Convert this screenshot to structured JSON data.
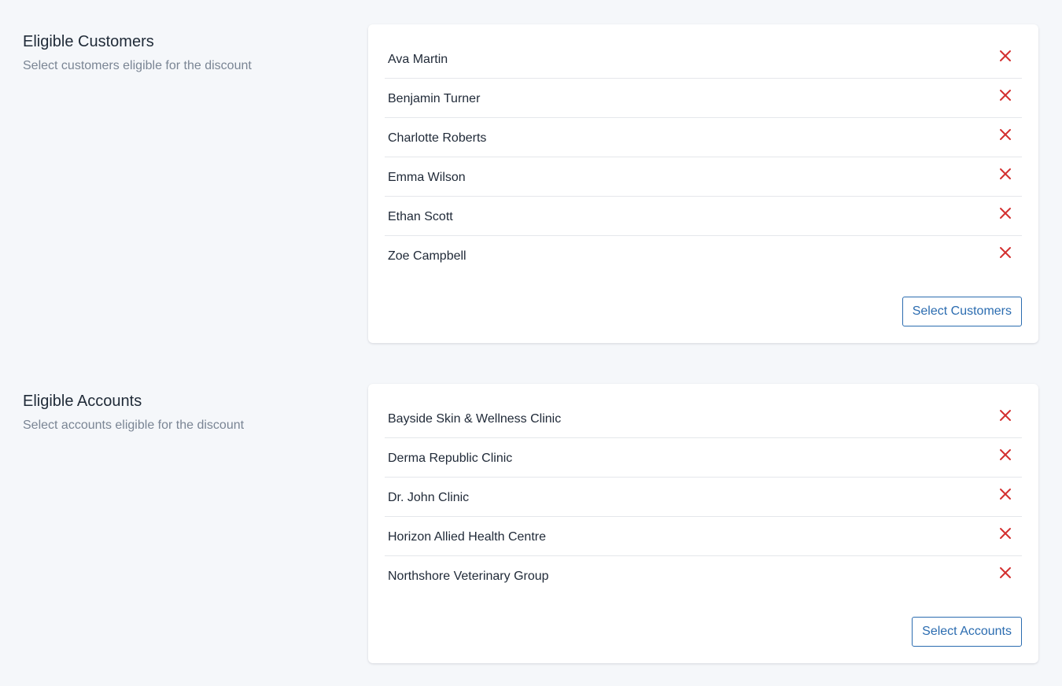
{
  "customers": {
    "title": "Eligible Customers",
    "description": "Select customers eligible for the discount",
    "items": [
      {
        "name": "Ava Martin"
      },
      {
        "name": "Benjamin Turner"
      },
      {
        "name": "Charlotte Roberts"
      },
      {
        "name": "Emma Wilson"
      },
      {
        "name": "Ethan Scott"
      },
      {
        "name": "Zoe Campbell"
      }
    ],
    "select_label": "Select Customers"
  },
  "accounts": {
    "title": "Eligible Accounts",
    "description": "Select accounts eligible for the discount",
    "items": [
      {
        "name": "Bayside Skin & Wellness Clinic"
      },
      {
        "name": "Derma Republic Clinic"
      },
      {
        "name": "Dr. John Clinic"
      },
      {
        "name": "Horizon Allied Health Centre"
      },
      {
        "name": "Northshore Veterinary Group"
      }
    ],
    "select_label": "Select Accounts"
  },
  "icons": {
    "remove": "close-icon"
  },
  "colors": {
    "background": "#f5f7fa",
    "remove_icon": "#d32f2f",
    "primary": "#2b6cb0",
    "muted_text": "#7a8594"
  }
}
